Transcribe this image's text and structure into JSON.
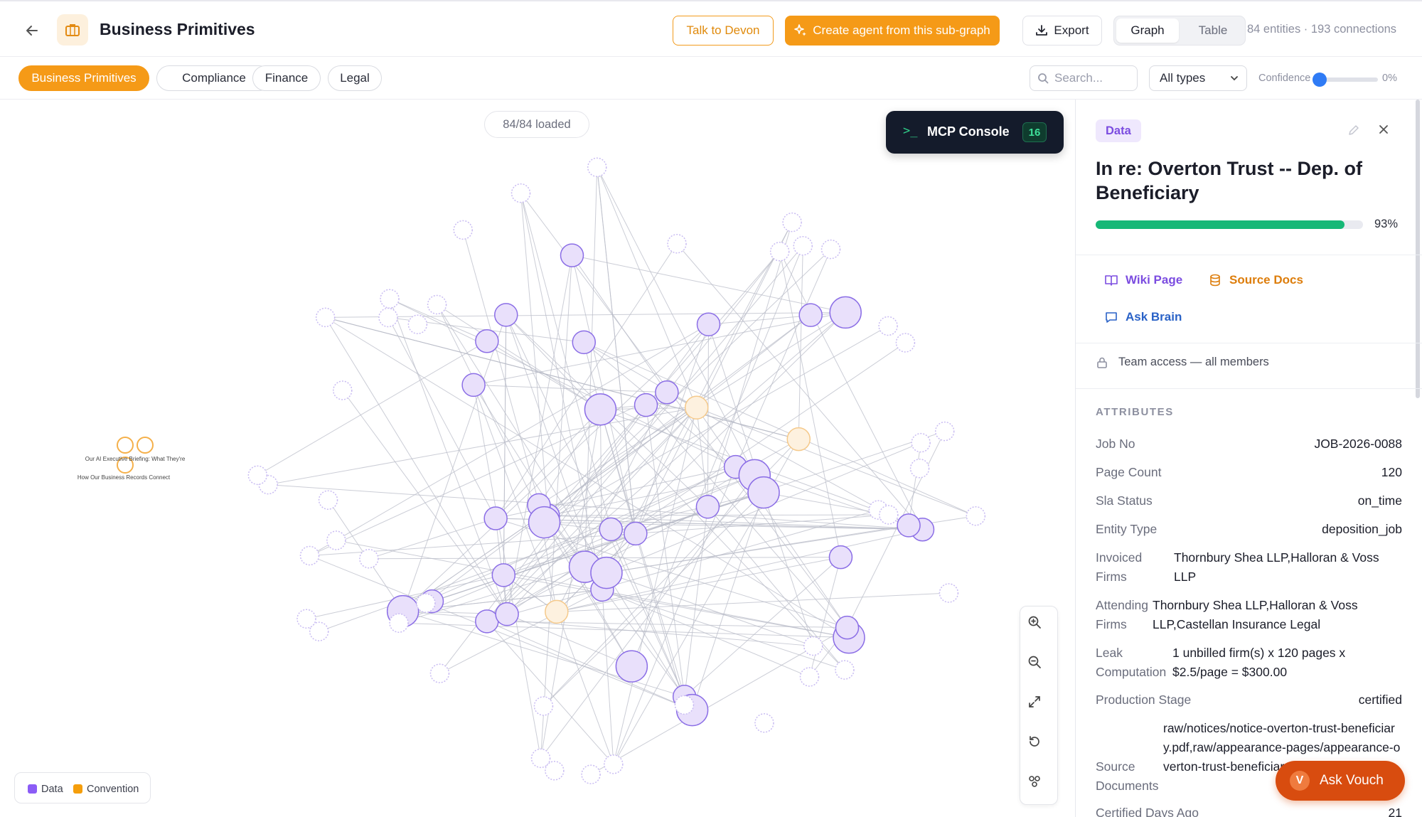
{
  "header": {
    "title": "Business Primitives",
    "talk_label": "Talk to Devon",
    "create_label": "Create agent from this sub-graph",
    "export_label": "Export",
    "view_graph": "Graph",
    "view_table": "Table",
    "stats": "84 entities · 193 connections"
  },
  "filters": {
    "chips": [
      "Business Primitives",
      "Compliance",
      "Finance",
      "Legal"
    ],
    "active": "Business Primitives",
    "search_placeholder": "Search...",
    "type_select": "All types",
    "confidence_label": "Confidence",
    "confidence_value": "0%"
  },
  "canvas": {
    "loaded": "84/84 loaded",
    "mcp_label": "MCP Console",
    "mcp_prompt": ">_",
    "mcp_count": "16",
    "legend": [
      {
        "label": "Data",
        "color": "#8b5cf6"
      },
      {
        "label": "Convention",
        "color": "#f59e0b"
      }
    ],
    "isolated_labels": [
      "Our AI Executive Briefing: What They're",
      "How Our Business Records Connect"
    ]
  },
  "panel": {
    "tag": "Data",
    "title": "In re: Overton Trust -- Dep. of Beneficiary",
    "confidence": 0.93,
    "confidence_label": "93%",
    "links": {
      "wiki": "Wiki Page",
      "source": "Source Docs",
      "ask": "Ask Brain"
    },
    "access": "Team access — all members",
    "attributes_heading": "ATTRIBUTES",
    "attributes": [
      {
        "key": "Job No",
        "value": "JOB-2026-0088"
      },
      {
        "key": "Page Count",
        "value": "120"
      },
      {
        "key": "Sla Status",
        "value": "on_time"
      },
      {
        "key": "Entity Type",
        "value": "deposition_job"
      },
      {
        "key": "Invoiced Firms",
        "value": "Thornbury Shea LLP,Halloran & Voss LLP"
      },
      {
        "key": "Attending Firms",
        "value": "Thornbury Shea LLP,Halloran & Voss LLP,Castellan Insurance Legal"
      },
      {
        "key": "Leak Computation",
        "value": "1 unbilled firm(s) x 120 pages x $2.5/page = $300.00"
      },
      {
        "key": "Production Stage",
        "value": "certified"
      },
      {
        "key": "Source Documents",
        "value": "raw/notices/notice-overton-trust-beneficiary.pdf,raw/appearance-pages/appearance-overton-trust-beneficiary.pdf"
      },
      {
        "key": "Certified Days Ago",
        "value": "21"
      }
    ]
  },
  "ask_vouch": "Ask Vouch",
  "colors": {
    "accent": "#f59a17",
    "node_fill": "#e9e0fb",
    "node_stroke": "#8b6ee6",
    "convention": "#f5b04a",
    "edge": "#b9bcc8"
  }
}
